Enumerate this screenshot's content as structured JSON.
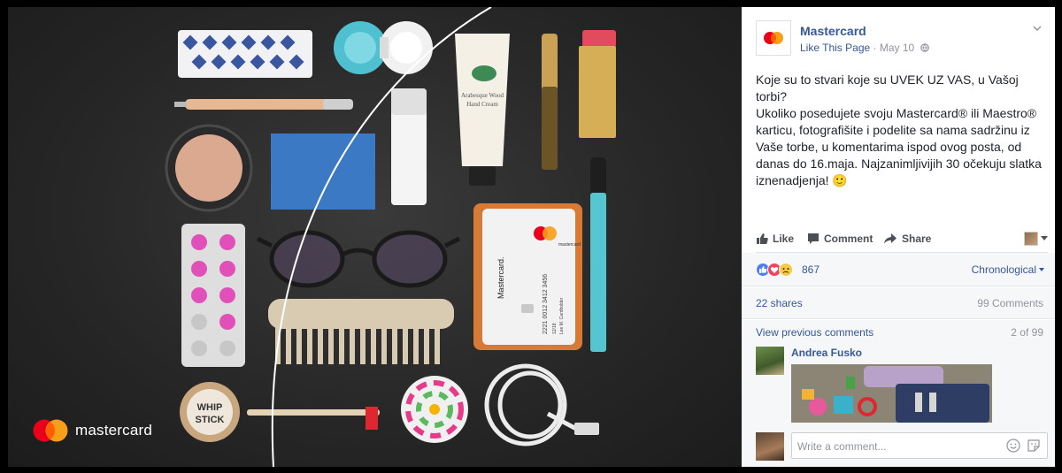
{
  "photo": {
    "brand_text": "mastercard",
    "card_brand_vertical": "Mastercard.",
    "card_number": "2221 0012 3412 3456",
    "card_holder": "Lee M. Cardholder",
    "card_expiry": "12/18",
    "card_logo_word": "mastercard",
    "balm_text_1": "WHIP",
    "balm_text_2": "STICK",
    "cream_text_1": "Arabesque Wood",
    "cream_text_2": "Hand Cream"
  },
  "post": {
    "page_name": "Mastercard",
    "like_page": "Like This Page",
    "date": "May 10",
    "separator": "·",
    "text_1": "Koje su to stvari koje su UVEK UZ VAS, u Vašoj torbi?",
    "text_2": "Ukoliko posedujete svoju Mastercard® ili Maestro® karticu, fotografišite i podelite sa nama sadržinu iz Vaše torbe, u komentarima ispod ovog posta, od danas do 16.maja. Najzanimljivijih 30 očekuju slatka iznenadjenja! ",
    "emoji": "🙂"
  },
  "actions": {
    "like": "Like",
    "comment": "Comment",
    "share": "Share"
  },
  "reactions": {
    "count": "867",
    "order": "Chronological"
  },
  "stats": {
    "shares": "22 shares",
    "comments": "99 Comments"
  },
  "comments": {
    "view_previous": "View previous comments",
    "pager": "2 of 99",
    "first_author": "Andrea Fusko",
    "write_placeholder": "Write a comment..."
  },
  "colors": {
    "fb_blue": "#365899",
    "mc_red": "#eb001b",
    "mc_orange": "#f79e1b",
    "mc_overlap": "#ff5f00"
  }
}
